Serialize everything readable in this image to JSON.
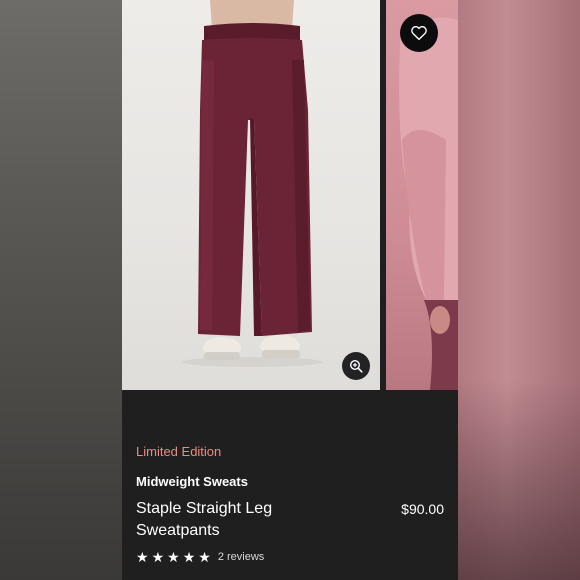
{
  "product": {
    "badge": "Limited Edition",
    "collection": "Midweight Sweats",
    "title": "Staple Straight Leg Sweatpants",
    "price": "$90.00",
    "rating": 5,
    "reviews": "2 reviews"
  },
  "colors": {
    "badge": "#f08a80",
    "background": "#1f1f20",
    "main_product_color": "#6b2436",
    "second_product_color": "#d99aa2"
  },
  "icons": {
    "wishlist": "heart-icon",
    "zoom": "zoom-in-icon",
    "rating_star": "star-icon"
  }
}
